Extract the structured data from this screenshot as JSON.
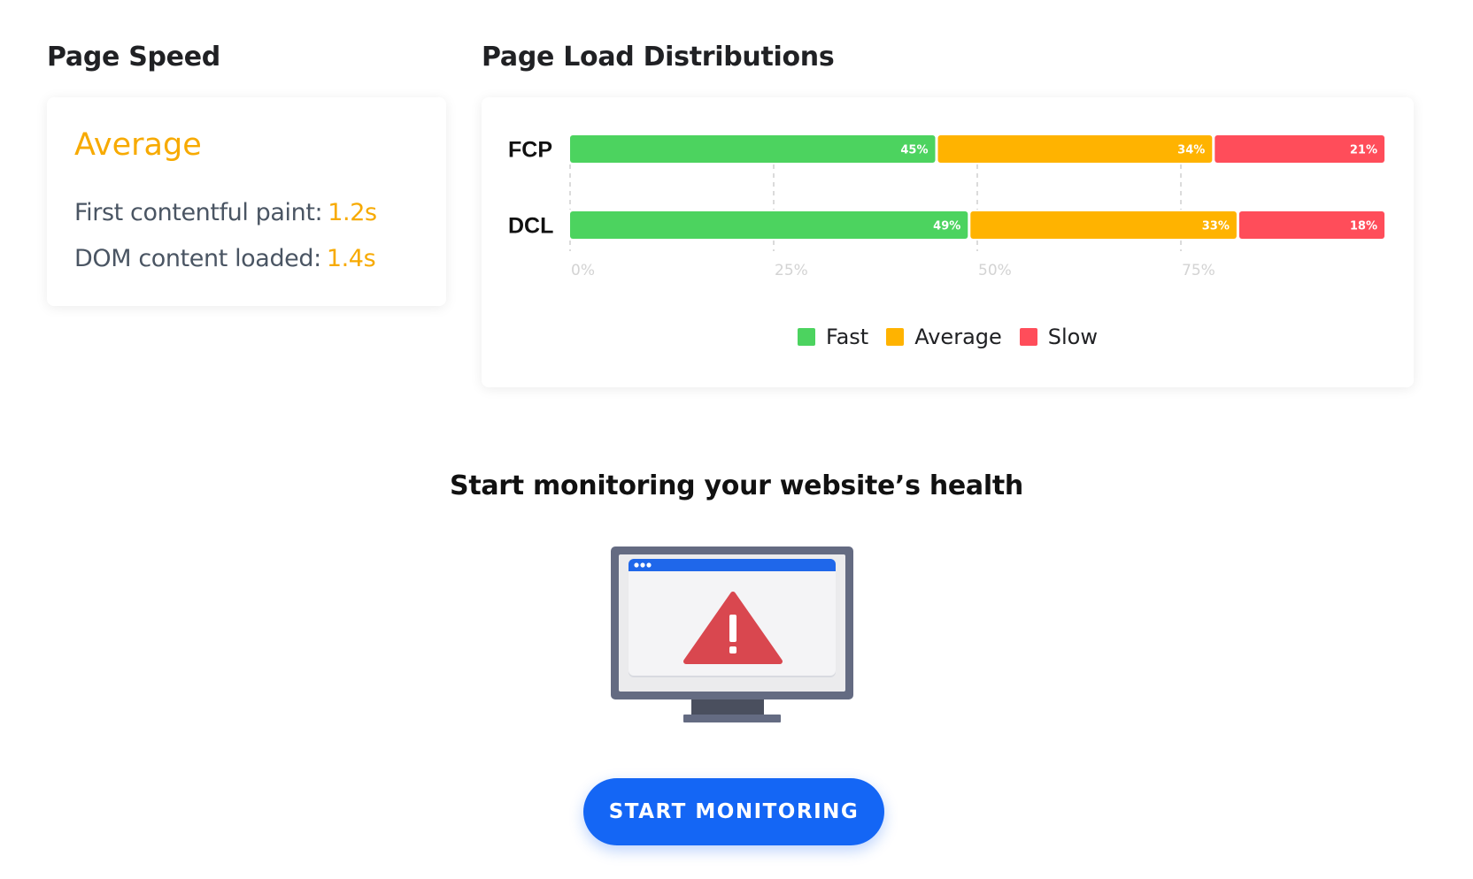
{
  "page_speed": {
    "title": "Page Speed",
    "rating": "Average",
    "rating_color": "#f7aa00",
    "metrics": [
      {
        "label": "First contentful paint:",
        "value": "1.2s"
      },
      {
        "label": "DOM content loaded:",
        "value": "1.4s"
      }
    ]
  },
  "distributions": {
    "title": "Page Load Distributions",
    "legend": [
      {
        "label": "Fast",
        "color": "#4cd35f"
      },
      {
        "label": "Average",
        "color": "#ffb300"
      },
      {
        "label": "Slow",
        "color": "#ff4d5a"
      }
    ]
  },
  "chart_data": {
    "type": "bar",
    "orientation": "horizontal",
    "stacked": true,
    "categories": [
      "FCP",
      "DCL"
    ],
    "series": [
      {
        "name": "Fast",
        "values": [
          45,
          49
        ],
        "labels": [
          "45%",
          "49%"
        ],
        "color": "#4cd35f"
      },
      {
        "name": "Average",
        "values": [
          34,
          33
        ],
        "labels": [
          "34%",
          "33%"
        ],
        "color": "#ffb300"
      },
      {
        "name": "Slow",
        "values": [
          21,
          18
        ],
        "labels": [
          "21%",
          "18%"
        ],
        "color": "#ff4d5a"
      }
    ],
    "x_ticks": [
      {
        "value": 0,
        "label": "0%"
      },
      {
        "value": 25,
        "label": "25%"
      },
      {
        "value": 50,
        "label": "50%"
      },
      {
        "value": 75,
        "label": "75%"
      }
    ],
    "xlim": [
      0,
      100
    ],
    "grid": "dashed vertical",
    "legend_position": "bottom-center"
  },
  "cta": {
    "title": "Start monitoring your website’s health",
    "button_label": "START MONITORING",
    "button_color": "#1466f5",
    "illustration_icon": "monitor-warning-icon"
  }
}
